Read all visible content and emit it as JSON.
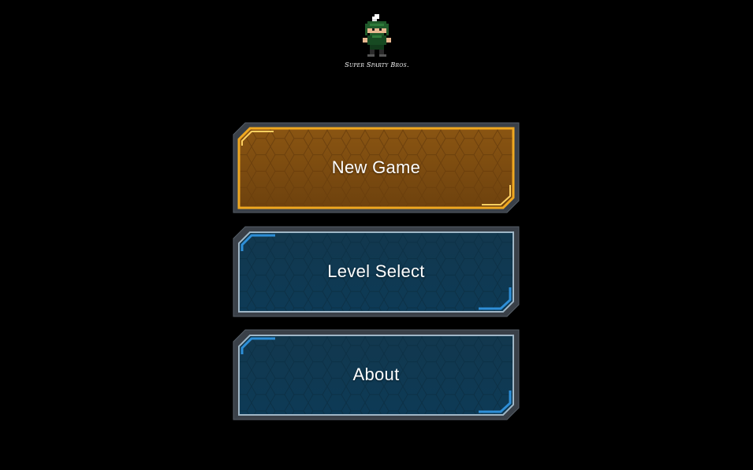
{
  "logo": {
    "title": "Super Sparty Bros.",
    "sprite": "pixel-spartan-character-icon"
  },
  "menu": {
    "buttons": [
      {
        "label": "New Game",
        "state": "highlighted",
        "theme": "orange"
      },
      {
        "label": "Level Select",
        "state": "normal",
        "theme": "blue"
      },
      {
        "label": "About",
        "state": "normal",
        "theme": "blue"
      }
    ]
  },
  "colors": {
    "background": "#000000",
    "orange_fill": "#7a4a10",
    "orange_border": "#f0a820",
    "blue_fill": "#0f3a52",
    "blue_border": "#2e8fd8",
    "frame": "#3a4048",
    "label": "#ffffff"
  }
}
